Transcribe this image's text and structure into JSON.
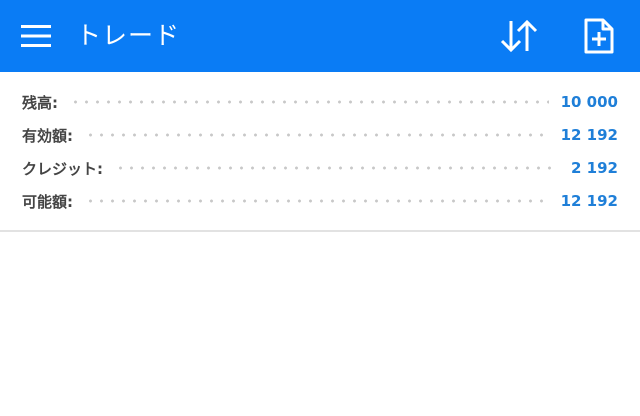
{
  "header": {
    "title": "トレード",
    "menu_icon": "hamburger-menu-icon",
    "sort_icon": "sort-arrows-icon",
    "new_order_icon": "document-plus-icon",
    "background_color": "#0a7cf5"
  },
  "summary": {
    "rows": [
      {
        "label": "残高:",
        "value": "10 000"
      },
      {
        "label": "有効額:",
        "value": "12 192"
      },
      {
        "label": "クレジット:",
        "value": "2 192"
      },
      {
        "label": "可能額:",
        "value": "12 192"
      }
    ],
    "value_color": "#1f7fd8"
  }
}
